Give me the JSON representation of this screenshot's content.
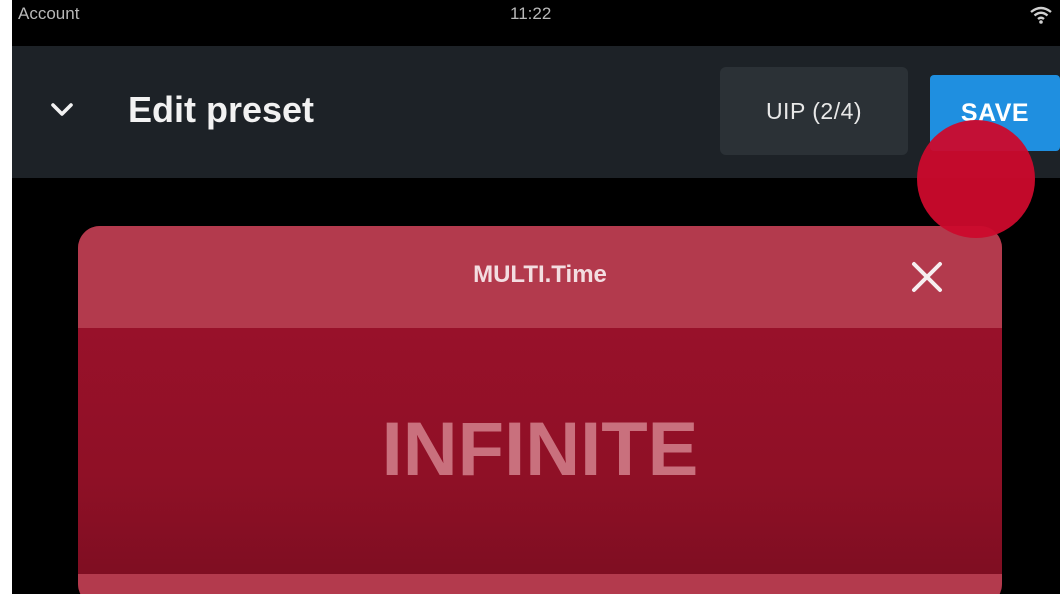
{
  "status_bar": {
    "left_label": "Account",
    "time": "11:22",
    "wifi_icon": "wifi-icon"
  },
  "header": {
    "back_icon": "chevron-down-icon",
    "title": "Edit preset",
    "uip_label": "UIP (2/4)",
    "save_label": "SAVE"
  },
  "dialog": {
    "title": "MULTI.Time",
    "close_icon": "close-icon",
    "value": "INFINITE"
  },
  "colors": {
    "app_bar": "#1d2227",
    "save_button": "#1f8fe0",
    "card_header": "#b33a4d",
    "card_body": "#951127",
    "touch_indicator": "#cc0a2c"
  }
}
